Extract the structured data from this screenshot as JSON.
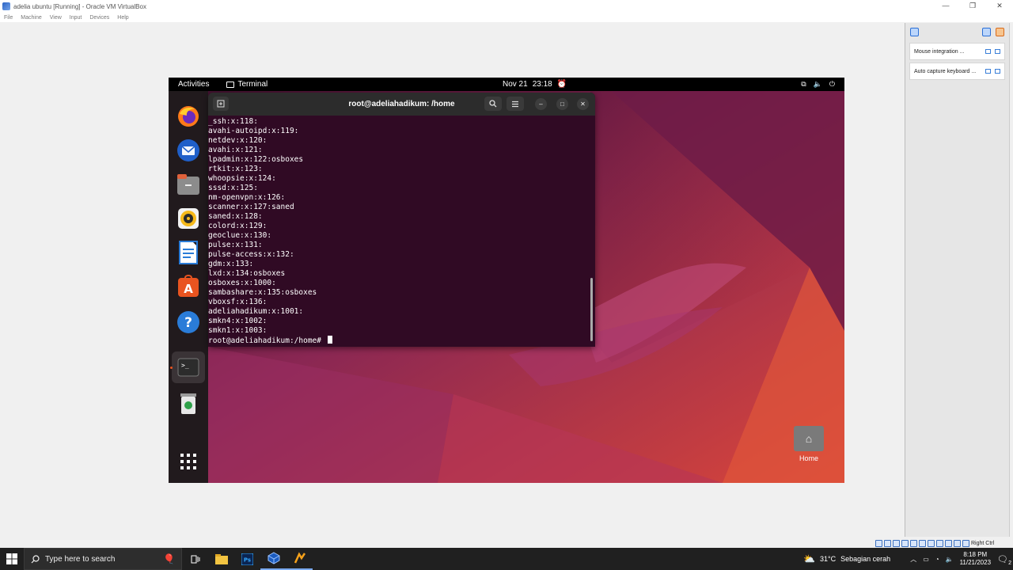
{
  "host": {
    "title": "adelia ubuntu [Running] - Oracle VM VirtualBox",
    "menu": [
      "File",
      "Machine",
      "View",
      "Input",
      "Devices",
      "Help"
    ],
    "window_controls": [
      "—",
      "❐",
      "✕"
    ]
  },
  "right_panel": {
    "rows": [
      {
        "label": "Mouse integration ..."
      },
      {
        "label": "Auto capture keyboard ..."
      }
    ]
  },
  "status_strip": {
    "host_key": "Right Ctrl"
  },
  "guest": {
    "topbar": {
      "activities": "Activities",
      "app": "Terminal",
      "date": "Nov 21",
      "time": "23:18"
    },
    "dock": [
      "firefox-icon",
      "thunderbird-icon",
      "files-icon",
      "rhythmbox-icon",
      "writer-icon",
      "app-center-icon",
      "help-icon",
      "terminal-icon",
      "trash-icon",
      "show-apps-icon"
    ],
    "desktop_home_label": "Home",
    "terminal": {
      "title": "root@adeliahadikum: /home",
      "lines": [
        "_ssh:x:118:",
        "avahi-autoipd:x:119:",
        "netdev:x:120:",
        "avahi:x:121:",
        "lpadmin:x:122:osboxes",
        "rtkit:x:123:",
        "whoopsie:x:124:",
        "sssd:x:125:",
        "nm-openvpn:x:126:",
        "scanner:x:127:saned",
        "saned:x:128:",
        "colord:x:129:",
        "geoclue:x:130:",
        "pulse:x:131:",
        "pulse-access:x:132:",
        "gdm:x:133:",
        "lxd:x:134:osboxes",
        "osboxes:x:1000:",
        "sambashare:x:135:osboxes",
        "vboxsf:x:136:",
        "adeliahadikum:x:1001:",
        "smkn4:x:1002:",
        "smkn1:x:1003:"
      ],
      "prompt": "root@adeliahadikum:/home# "
    }
  },
  "taskbar": {
    "search_placeholder": "Type here to search",
    "weather_temp": "31°C",
    "weather_text": "Sebagian cerah",
    "clock_time": "8:18 PM",
    "clock_date": "11/21/2023",
    "notification_count": "2"
  }
}
